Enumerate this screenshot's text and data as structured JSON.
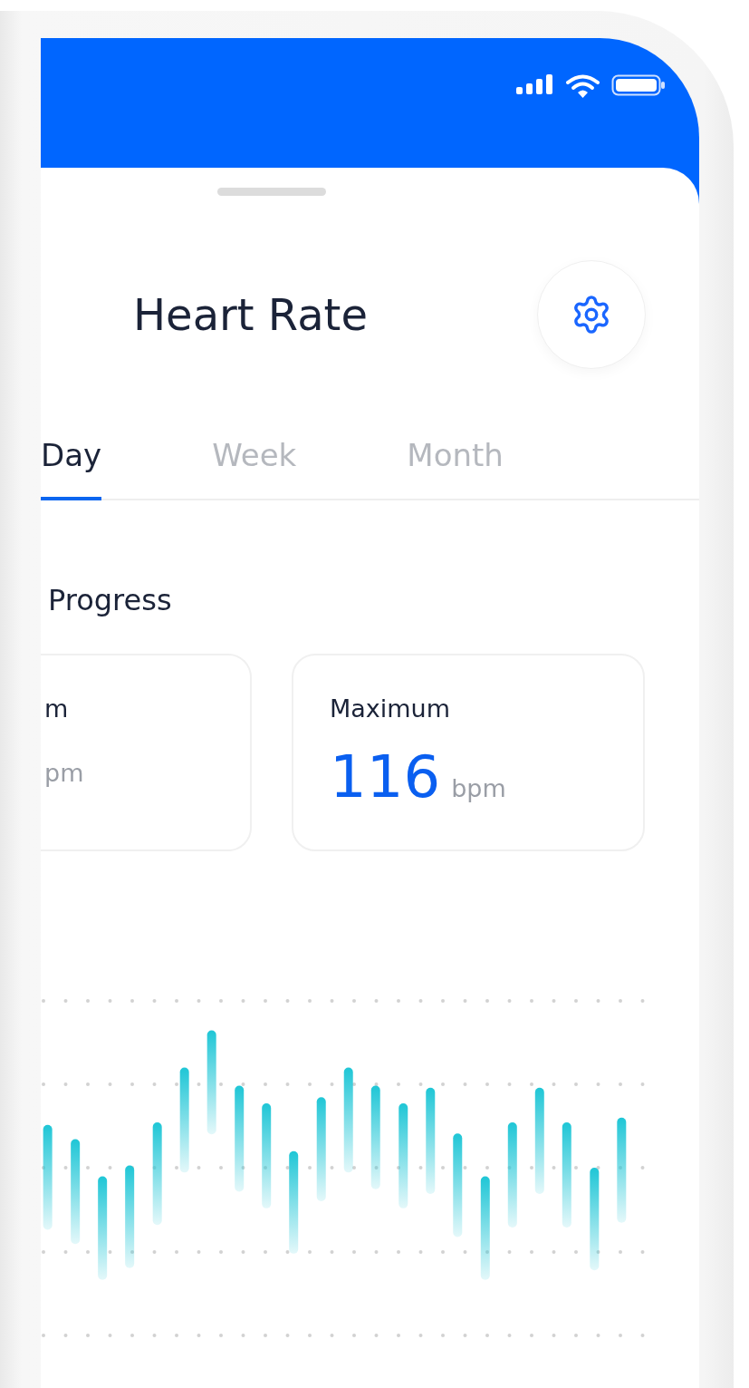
{
  "title": "Heart Rate",
  "tabs": [
    {
      "label": "Day",
      "selected": true
    },
    {
      "label": "Week",
      "selected": false
    },
    {
      "label": "Month",
      "selected": false
    }
  ],
  "section_title": "Progress",
  "stats": [
    {
      "label": "m",
      "unit": "pm"
    },
    {
      "label": "Maximum",
      "value": "116",
      "unit": "bpm"
    }
  ]
}
